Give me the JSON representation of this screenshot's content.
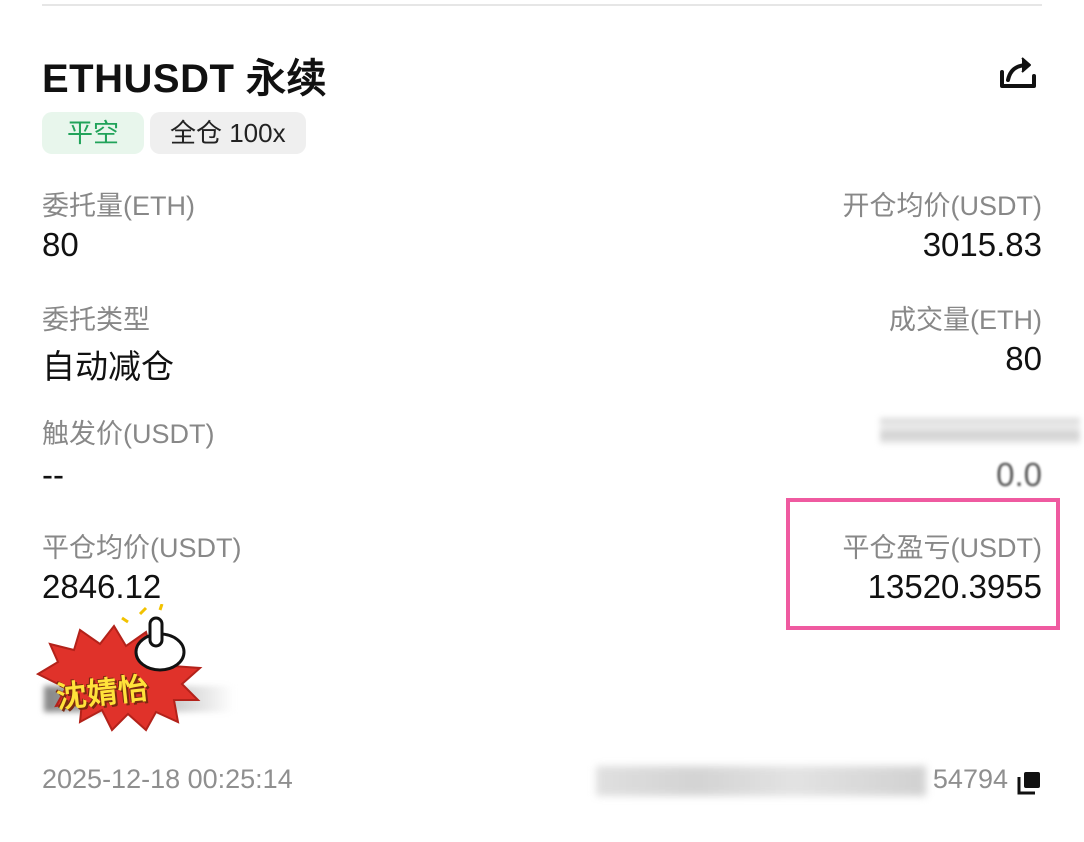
{
  "header": {
    "title": "ETHUSDT 永续",
    "share_icon": "share-icon"
  },
  "tags": {
    "side": "平空",
    "margin_mode": "全仓 100x"
  },
  "colors": {
    "side_tag_text": "#21a35a",
    "side_tag_bg": "#e8f6ec",
    "highlight_border": "#ef5aa0"
  },
  "fields": {
    "order_qty": {
      "label": "委托量(ETH)",
      "value": "80"
    },
    "avg_open_price": {
      "label": "开仓均价(USDT)",
      "value": "3015.83"
    },
    "order_type": {
      "label": "委托类型",
      "value": "自动减仓"
    },
    "filled_qty": {
      "label": "成交量(ETH)",
      "value": "80"
    },
    "trigger_price": {
      "label": "触发价(USDT)",
      "value": "--"
    },
    "obscured_value": "0.0",
    "avg_close_price": {
      "label": "平仓均价(USDT)",
      "value": "2846.12"
    },
    "close_pnl": {
      "label": "平仓盈亏(USDT)",
      "value": "13520.3955"
    }
  },
  "watermark": {
    "text": "沈婧怡"
  },
  "footer": {
    "timestamp": "2025-12-18 00:25:14",
    "position_id_suffix": "54794",
    "copy_icon": "copy-icon"
  }
}
